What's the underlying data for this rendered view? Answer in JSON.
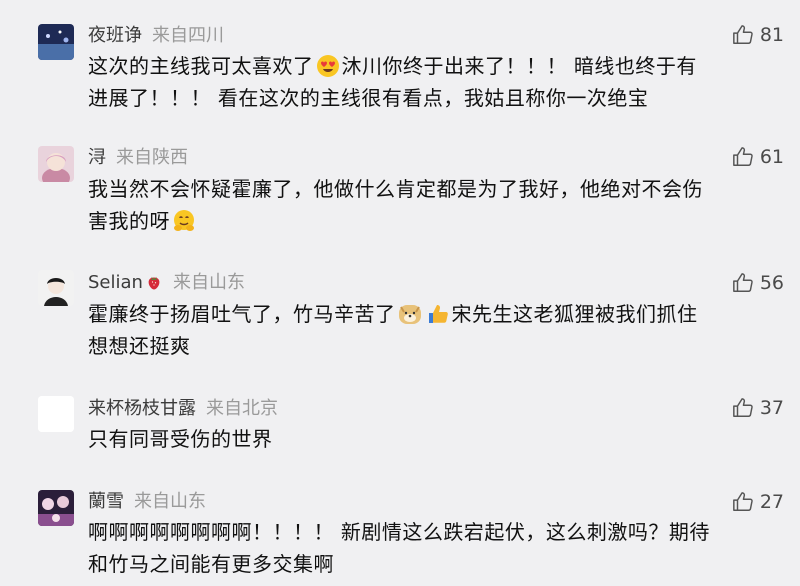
{
  "comments": [
    {
      "username": "夜班诤",
      "location": "来自四川",
      "likes": "81",
      "line1a": "这次的主线我可太喜欢了",
      "line1b": "沐川你终于出来了！！！ 暗线也终于有",
      "line2": "进展了！！！ 看在这次的主线很有看点，我姑且称你一次绝宝"
    },
    {
      "username": "浔",
      "location": "来自陕西",
      "likes": "61",
      "line1": "我当然不会怀疑霍廉了，他做什么肯定都是为了我好，他绝对不会伤",
      "line2": "害我的呀"
    },
    {
      "username": "Selian",
      "location": "来自山东",
      "likes": "56",
      "line1a": "霍廉终于扬眉吐气了，竹马辛苦了",
      "line1b": "宋先生这老狐狸被我们抓住",
      "line2": "想想还挺爽"
    },
    {
      "username": "来杯杨枝甘露",
      "location": "来自北京",
      "likes": "37",
      "line1": "只有同哥受伤的世界"
    },
    {
      "username": "蘭雪",
      "location": "来自山东",
      "likes": "27",
      "line1": "啊啊啊啊啊啊啊啊！！！！ 新剧情这么跌宕起伏，这么刺激吗？期待",
      "line2": "和竹马之间能有更多交集啊"
    }
  ]
}
